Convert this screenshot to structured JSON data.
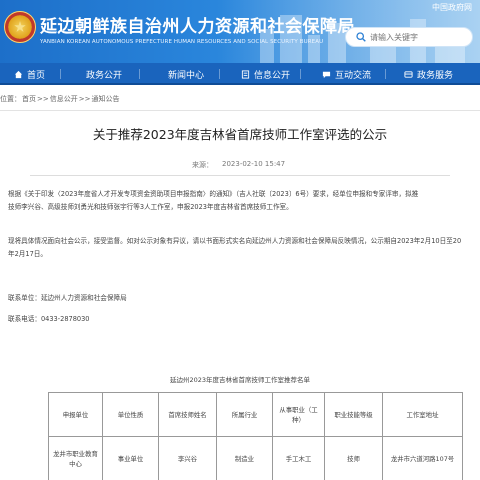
{
  "header": {
    "title": "延边朝鲜族自治州人力资源和社会保障局",
    "subtitle": "YANBIAN KOREAN AUTONOMOUS PREFECTURE HUMAN RESOURCES AND SOCIAL SECURITY BUREAU",
    "top_link": "中国政府网",
    "search_placeholder": "请输入关键字",
    "colors": {
      "header_blue": "#1d6fc9",
      "nav_blue": "#1a64bd"
    }
  },
  "nav": {
    "items": [
      {
        "label": "首页",
        "icon": "home-icon"
      },
      {
        "label": "政务公开",
        "icon": "grid-icon"
      },
      {
        "label": "新闻中心",
        "icon": "news-icon"
      },
      {
        "label": "信息公开",
        "icon": "info-icon"
      },
      {
        "label": "互动交流",
        "icon": "chat-icon"
      },
      {
        "label": "政务服务",
        "icon": "service-icon"
      }
    ]
  },
  "breadcrumb": {
    "prefix": "位置：",
    "items": [
      "首页",
      "信息公开",
      "通知公告"
    ],
    "separator": ">>"
  },
  "article": {
    "title": "关于推荐2023年度吉林省首席技师工作室评选的公示",
    "source_label": "来源：",
    "time": "2023-02-10 15:47",
    "paragraphs": [
      "根据《关于印发〈2023年度省人才开发专项资金资助项目申报指南〉的通知》（吉人社联〔2023〕6号）要求，经单位申报和专家评审，拟推",
      "技师李兴谷、高级技师刘勇光和技师张宇行等3人工作室，申报2023年度吉林省首席技师工作室。",
      "现将具体情况面向社会公示，接受监督。如对公示对象有异议，请以书面形式实名向延边州人力资源和社会保障局反映情况，公示期自2023年2月10日至20",
      "年2月17日。"
    ],
    "contact_unit": "联系单位：延边州人力资源和社会保障局",
    "contact_phone": "联系电话：0433-2878030"
  },
  "table": {
    "title": "延边州2023年度吉林省首席技师工作室推荐名单",
    "headers": [
      "申报单位",
      "单位性质",
      "首席技师姓名",
      "所属行业",
      "从事职业（工种）",
      "职业技能等级",
      "工作室地址"
    ],
    "rows": [
      [
        "龙井市职业教育中心",
        "事业单位",
        "李兴谷",
        "制造业",
        "手工木工",
        "技师",
        "龙井市六道河路107号"
      ]
    ]
  }
}
